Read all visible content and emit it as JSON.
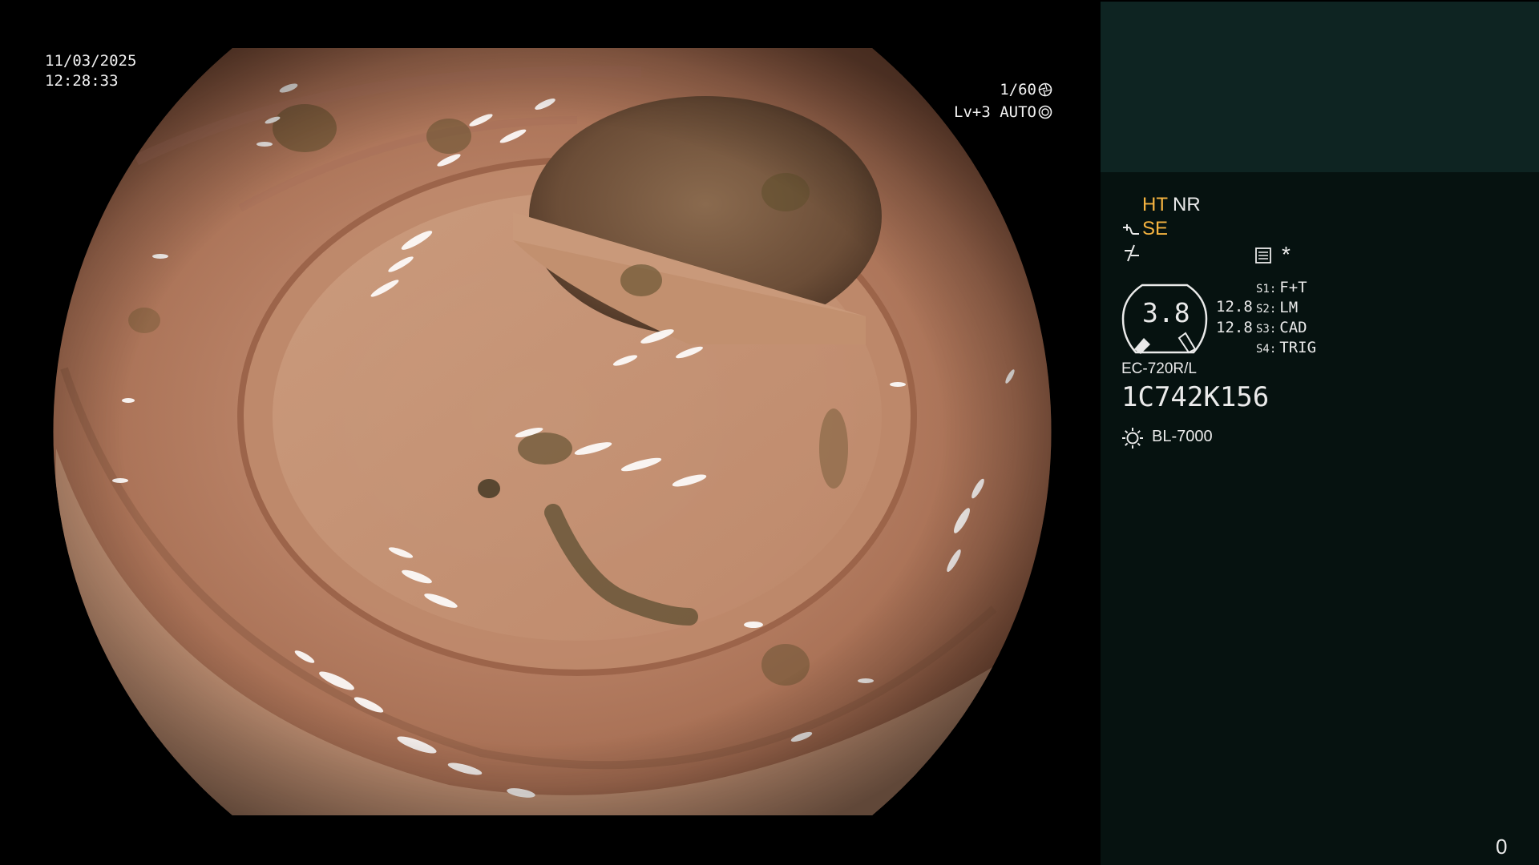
{
  "overlay": {
    "date": "11/03/2025",
    "time": "12:28:33",
    "shutter": "1/60",
    "level": "Lv+3 AUTO"
  },
  "status": {
    "ht": "HT",
    "nr": "NR",
    "se": "SE",
    "star": "*",
    "iris_value": "3.8",
    "value_a": "12.8",
    "value_b": "12.8",
    "switches": [
      {
        "key": "S1:",
        "value": "F+T"
      },
      {
        "key": "S2:",
        "value": "LM"
      },
      {
        "key": "S3:",
        "value": "CAD"
      },
      {
        "key": "S4:",
        "value": "TRIG"
      }
    ],
    "scope_model": "EC-720R/L",
    "serial": "1C742K156",
    "light_source": "BL-7000",
    "counter": "0"
  },
  "icons": {
    "shutter": "shutter-icon",
    "auto": "auto-iris-icon",
    "se": "structure-enhance-icon",
    "enhance": "enhance-icon",
    "memo": "memo-icon",
    "light": "light-source-icon"
  },
  "colors": {
    "amber": "#f5b340",
    "panel_bg": "#061210",
    "panel_top": "#0e2422"
  }
}
